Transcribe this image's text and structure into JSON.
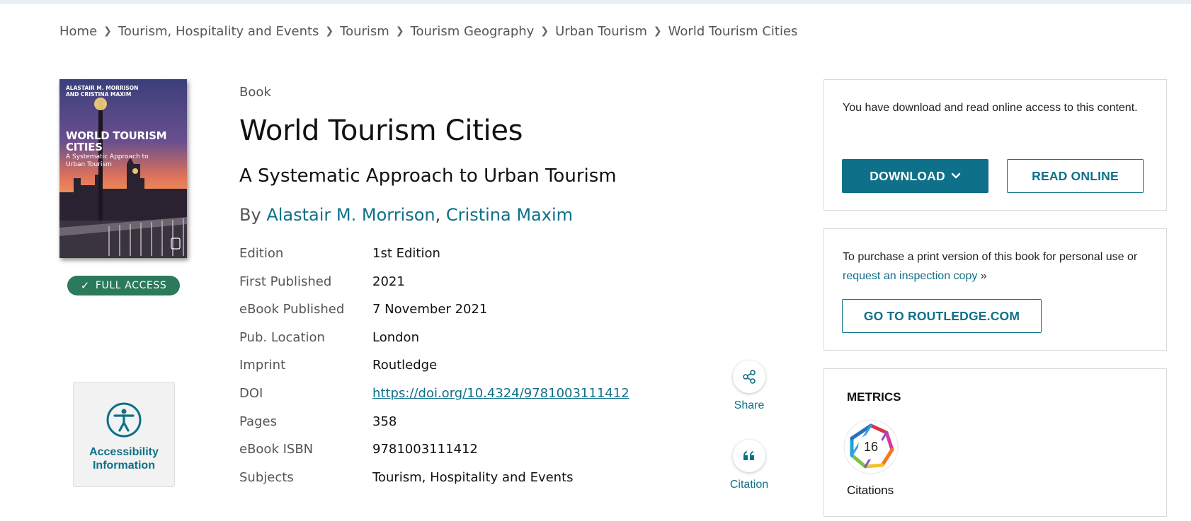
{
  "breadcrumb": [
    "Home",
    "Tourism, Hospitality and Events",
    "Tourism",
    "Tourism Geography",
    "Urban Tourism",
    "World Tourism Cities"
  ],
  "cover": {
    "authors_line1": "ALASTAIR M. MORRISON",
    "authors_line2": "AND CRISTINA MAXIM",
    "title_line1": "WORLD TOURISM",
    "title_line2": "CITIES",
    "subtitle_line1": "A Systematic Approach to",
    "subtitle_line2": "Urban Tourism"
  },
  "access_badge": "FULL ACCESS",
  "accessibility": {
    "line1": "Accessibility",
    "line2": "Information"
  },
  "book": {
    "type": "Book",
    "title": "World Tourism Cities",
    "subtitle": "A Systematic Approach to Urban Tourism",
    "by": "By",
    "author1": "Alastair M. Morrison",
    "comma": ",",
    "author2": "Cristina Maxim"
  },
  "meta": [
    {
      "k": "Edition",
      "v": "1st Edition"
    },
    {
      "k": "First Published",
      "v": "2021"
    },
    {
      "k": "eBook Published",
      "v": "7 November 2021"
    },
    {
      "k": "Pub. Location",
      "v": "London"
    },
    {
      "k": "Imprint",
      "v": "Routledge"
    },
    {
      "k": "DOI",
      "v": "https://doi.org/10.4324/9781003111412"
    },
    {
      "k": "Pages",
      "v": "358"
    },
    {
      "k": "eBook ISBN",
      "v": "9781003111412"
    },
    {
      "k": "Subjects",
      "v": "Tourism, Hospitality and Events"
    }
  ],
  "actions": {
    "share": "Share",
    "citation": "Citation"
  },
  "access_panel": {
    "text": "You have download and read online access to this content.",
    "download": "DOWNLOAD",
    "read_online": "READ ONLINE"
  },
  "purchase_panel": {
    "text": "To purchase a print version of this book for personal use or",
    "link": "request an inspection copy",
    "button": "GO TO ROUTLEDGE.COM"
  },
  "metrics": {
    "heading": "METRICS",
    "citations_count": "16",
    "citations_label": "Citations"
  },
  "colors": {
    "accent": "#0f7089",
    "badge_green": "#2a7a5b"
  }
}
